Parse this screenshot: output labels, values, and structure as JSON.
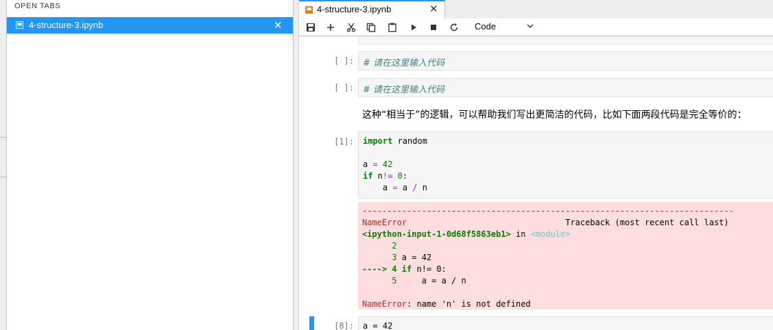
{
  "colors": {
    "accent": "#2196f3",
    "notebook_icon": "#f57c00",
    "error_bg": "#fddddd"
  },
  "left_panel": {
    "title": "OPEN TABS",
    "tabs": [
      {
        "name": "4-structure-3.ipynb",
        "icon": "notebook-icon"
      }
    ]
  },
  "editor": {
    "tab": {
      "name": "4-structure-3.ipynb"
    },
    "toolbar": {
      "buttons": [
        "save-icon",
        "add-icon",
        "cut-icon",
        "copy-icon",
        "paste-icon",
        "run-icon",
        "stop-icon",
        "restart-icon"
      ],
      "cell_type": "Code"
    }
  },
  "cells": {
    "c1": {
      "prompt": "[ ]:",
      "comment": "# 请在这里输入代码"
    },
    "c2": {
      "prompt": "[ ]:",
      "comment": "# 请在这里输入代码"
    },
    "md": {
      "text": "这种“相当于”的逻辑，可以帮助我们写出更简洁的代码，比如下面两段代码是完全等价的："
    },
    "c3": {
      "prompt": "[1]:",
      "code": {
        "kw_import": "import",
        "mod": " random",
        "a": "a ",
        "eq": "=",
        "n42": " 42",
        "kw_if": "if",
        "cond": " n",
        "ne": "!=",
        "zero": " 0",
        "colon": ":",
        "indent": "    a ",
        "eq2": "=",
        "a2": " a ",
        "div": "/",
        "n": " n"
      },
      "error": {
        "dashes": "---------------------------------------------------------------------------",
        "name": "NameError",
        "traceback": "Traceback (most recent call last)",
        "location": "<ipython-input-1-0d68f5863eb1>",
        "in_word": " in ",
        "module": "<module>",
        "l2": "      2",
        "l3num": "      3",
        "l3code": " a = 42",
        "l4arrow": "----> 4",
        "l4kw": " if",
        "l4code": " n!= 0:",
        "l5num": "      5",
        "l5code": "     a = a / n",
        "final_name": "NameError",
        "final_msg": ": name 'n' is not defined"
      }
    },
    "c4": {
      "prompt": "[8]:",
      "code": "a = 42"
    }
  }
}
